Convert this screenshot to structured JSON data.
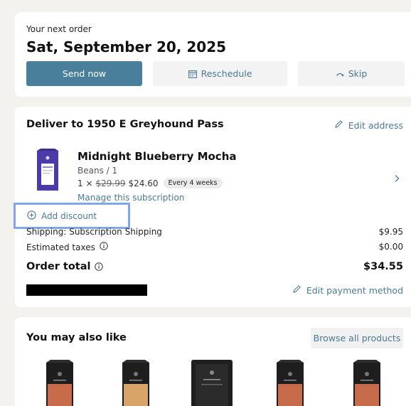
{
  "next_order": {
    "label": "Your next order",
    "date": "Sat, September 20, 2025",
    "send_now": "Send now",
    "reschedule": "Reschedule",
    "skip": "Skip"
  },
  "delivery": {
    "title": "Deliver to 1950 E Greyhound Pass",
    "edit_address": "Edit address",
    "product": {
      "name": "Midnight Blueberry Mocha",
      "variant": "Beans / 1",
      "qty_prefix": "1 ×",
      "original_price": "$29.99",
      "price": "$24.60",
      "frequency": "Every 4 weeks",
      "manage": "Manage this subscription"
    },
    "add_discount": "Add discount",
    "shipping_label": "Shipping: Subscription Shipping",
    "shipping_value": "$9.95",
    "taxes_label": "Estimated taxes",
    "taxes_value": "$0.00",
    "total_label": "Order total",
    "total_value": "$34.55",
    "edit_payment": "Edit payment method"
  },
  "recommendations": {
    "title": "You may also like",
    "browse_all": "Browse all products",
    "items": [
      {
        "name": "product-1",
        "color": "#c86b4a"
      },
      {
        "name": "product-2",
        "color": "#d9a46a"
      },
      {
        "name": "product-3",
        "color": "#2b2b2b"
      },
      {
        "name": "product-4",
        "color": "#c86b4a"
      },
      {
        "name": "product-5",
        "color": "#c86b4a"
      }
    ]
  },
  "colors": {
    "accent": "#4a7f9b",
    "link": "#4b7a93",
    "highlight": "#7ea7ec",
    "background": "#f3f2ee"
  }
}
